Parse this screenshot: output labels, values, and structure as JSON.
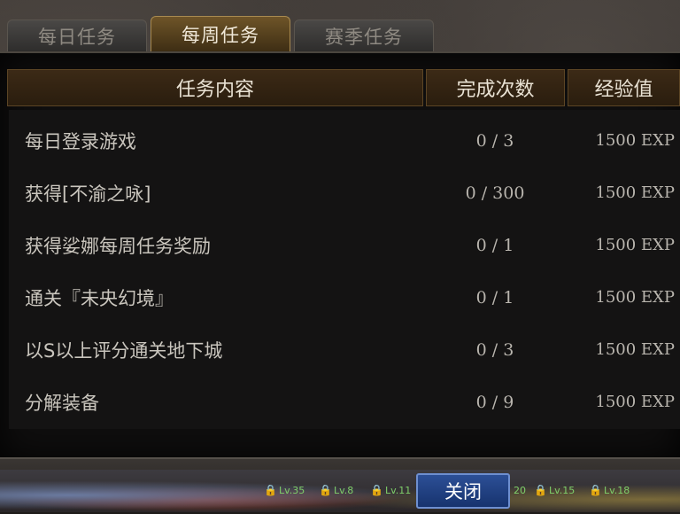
{
  "tabs": [
    {
      "label": "每日任务",
      "active": false
    },
    {
      "label": "每周任务",
      "active": true
    },
    {
      "label": "赛季任务",
      "active": false
    }
  ],
  "table": {
    "columns": [
      "任务内容",
      "完成次数",
      "经验值"
    ],
    "rows": [
      {
        "task": "每日登录游戏",
        "progress": "0 / 3",
        "exp": "1500 EXP"
      },
      {
        "task": "获得[不渝之咏]",
        "progress": "0 / 300",
        "exp": "1500 EXP"
      },
      {
        "task": "获得娑娜每周任务奖励",
        "progress": "0 / 1",
        "exp": "1500 EXP"
      },
      {
        "task": "通关『未央幻境』",
        "progress": "0 / 1",
        "exp": "1500 EXP"
      },
      {
        "task": "以S以上评分通关地下城",
        "progress": "0 / 3",
        "exp": "1500 EXP"
      },
      {
        "task": "分解装备",
        "progress": "0 / 9",
        "exp": "1500 EXP"
      }
    ]
  },
  "footer": {
    "close_label": "关闭",
    "level_badges": [
      "Lv.35",
      "Lv.8",
      "Lv.11",
      "20",
      "Lv.15",
      "Lv.18"
    ]
  },
  "colors": {
    "active_tab": "#6e5428",
    "header_bg": "#3c2a16",
    "close_button": "#2c4f96"
  },
  "icons": [
    "lock-icon"
  ]
}
